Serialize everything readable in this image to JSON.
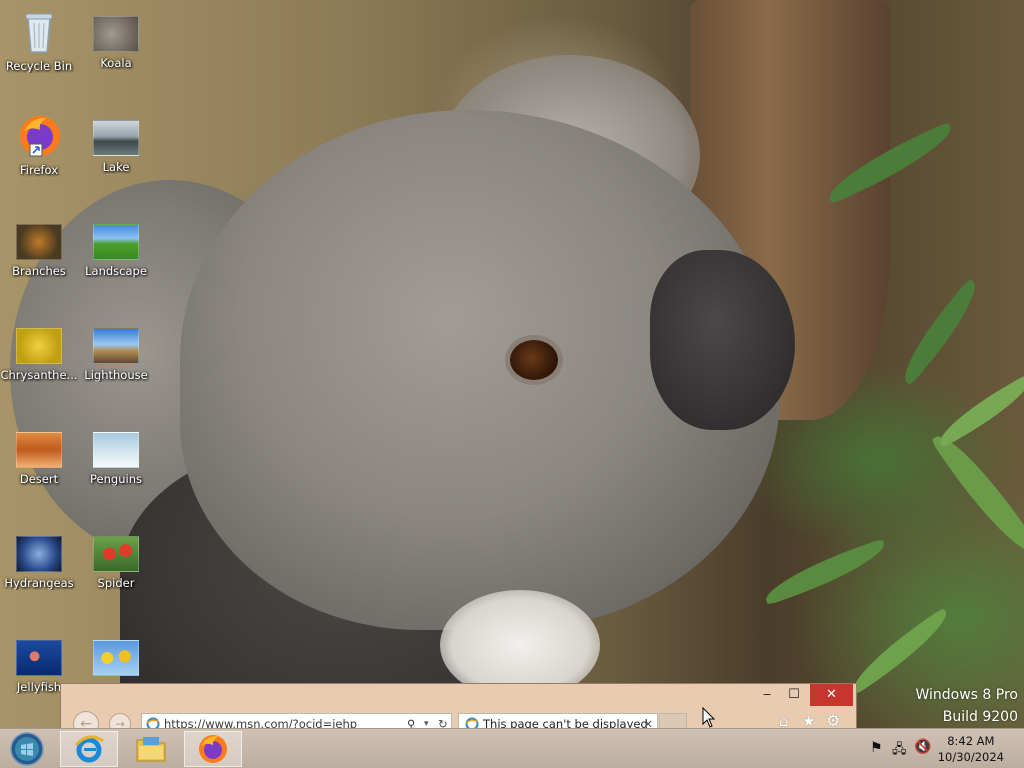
{
  "desktop": {
    "icons": [
      {
        "label": "Recycle Bin"
      },
      {
        "label": "Koala"
      },
      {
        "label": "Firefox"
      },
      {
        "label": "Lake"
      },
      {
        "label": "Branches"
      },
      {
        "label": "Landscape"
      },
      {
        "label": "Chrysanthe..."
      },
      {
        "label": "Lighthouse"
      },
      {
        "label": "Desert"
      },
      {
        "label": "Penguins"
      },
      {
        "label": "Hydrangeas"
      },
      {
        "label": "Spider"
      },
      {
        "label": "Jellyfish"
      },
      {
        "label": ""
      }
    ]
  },
  "ie_window": {
    "address": "https://www.msn.com/?ocid=iehp",
    "address_domain": "msn.com",
    "tab_title": "This page can't be displayed",
    "minimize_glyph": "‒",
    "maximize_glyph": "☐",
    "close_glyph": "✕",
    "close_color": "#c7362e"
  },
  "watermark": {
    "line1": "Windows 8 Pro",
    "line2": "Build 9200"
  },
  "taskbar": {
    "time": "8:42 AM",
    "date": "10/30/2024"
  }
}
